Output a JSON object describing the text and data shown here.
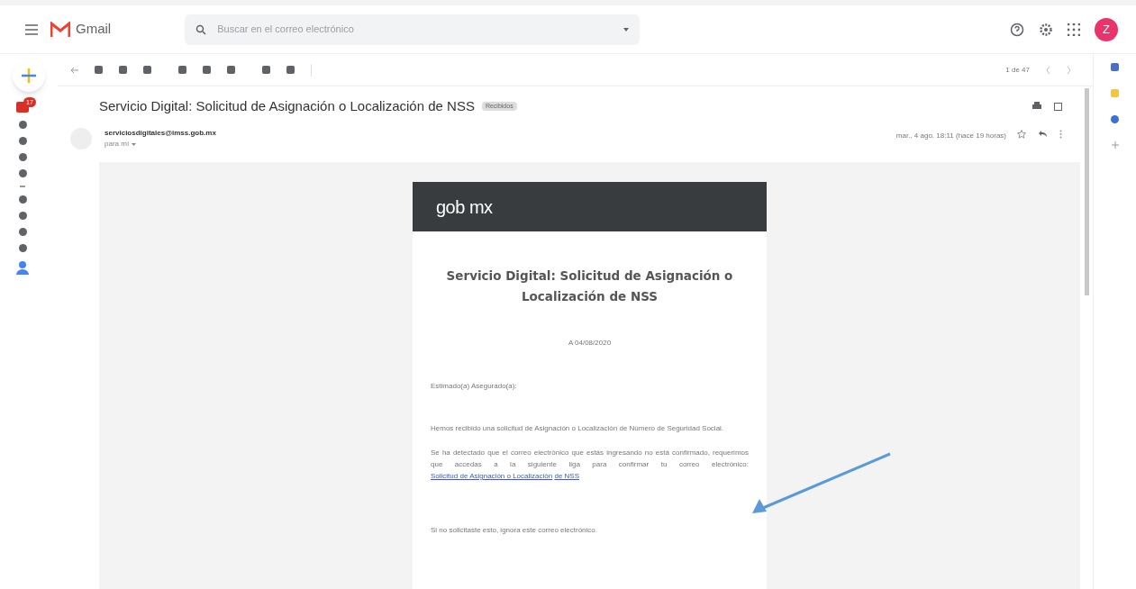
{
  "header": {
    "app_name": "Gmail",
    "search": {
      "placeholder": "Buscar en el correo electrónico"
    },
    "avatar": "Z"
  },
  "rail": {
    "inbox_badge": "17"
  },
  "toolbar": {
    "pagination": "1 de 47"
  },
  "message": {
    "subject": "Servicio Digital: Solicitud de Asignación o Localización de NSS",
    "label": "Recibidos",
    "sender": "serviciosdigitales@imss.gob.mx",
    "recipient": "para mí",
    "date": "mar., 4 ago. 18:11 (hace 19 horas)"
  },
  "email": {
    "brand": "gob mx",
    "title": "Servicio Digital: Solicitud de Asignación o Localización de NSS",
    "date": "A 04/08/2020",
    "greeting": "Estimado(a) Asegurado(a):",
    "paragraph_1": "Hemos recibido una solicitud de Asignación o Localización de Número de Seguridad Social.",
    "paragraph_2": "Se ha detectado que el correo electrónico que estás ingresando no está confirmado, requerimos que accedas a la siguiente liga para confirmar tu correo electrónico:",
    "link_line_1": "Solicitud de Asignación o Localización",
    "link_line_2": "de NSS",
    "closing": "Si no solicitaste esto, ignora este correo electrónico."
  }
}
